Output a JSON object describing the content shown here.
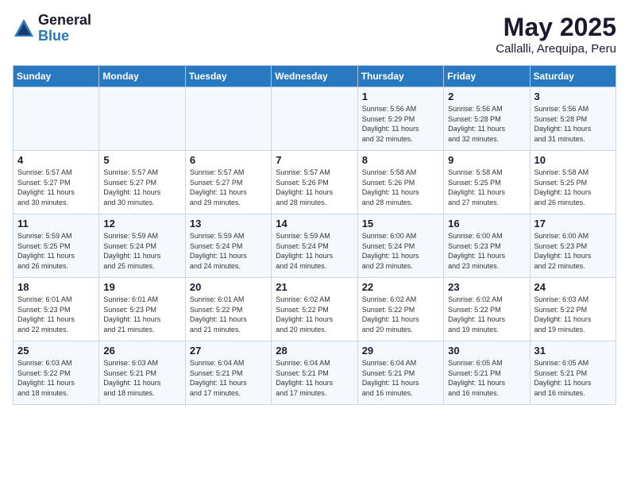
{
  "header": {
    "logo_general": "General",
    "logo_blue": "Blue",
    "month_year": "May 2025",
    "location": "Callalli, Arequipa, Peru"
  },
  "days_of_week": [
    "Sunday",
    "Monday",
    "Tuesday",
    "Wednesday",
    "Thursday",
    "Friday",
    "Saturday"
  ],
  "weeks": [
    [
      {
        "day": "",
        "info": ""
      },
      {
        "day": "",
        "info": ""
      },
      {
        "day": "",
        "info": ""
      },
      {
        "day": "",
        "info": ""
      },
      {
        "day": "1",
        "info": "Sunrise: 5:56 AM\nSunset: 5:29 PM\nDaylight: 11 hours\nand 32 minutes."
      },
      {
        "day": "2",
        "info": "Sunrise: 5:56 AM\nSunset: 5:28 PM\nDaylight: 11 hours\nand 32 minutes."
      },
      {
        "day": "3",
        "info": "Sunrise: 5:56 AM\nSunset: 5:28 PM\nDaylight: 11 hours\nand 31 minutes."
      }
    ],
    [
      {
        "day": "4",
        "info": "Sunrise: 5:57 AM\nSunset: 5:27 PM\nDaylight: 11 hours\nand 30 minutes."
      },
      {
        "day": "5",
        "info": "Sunrise: 5:57 AM\nSunset: 5:27 PM\nDaylight: 11 hours\nand 30 minutes."
      },
      {
        "day": "6",
        "info": "Sunrise: 5:57 AM\nSunset: 5:27 PM\nDaylight: 11 hours\nand 29 minutes."
      },
      {
        "day": "7",
        "info": "Sunrise: 5:57 AM\nSunset: 5:26 PM\nDaylight: 11 hours\nand 28 minutes."
      },
      {
        "day": "8",
        "info": "Sunrise: 5:58 AM\nSunset: 5:26 PM\nDaylight: 11 hours\nand 28 minutes."
      },
      {
        "day": "9",
        "info": "Sunrise: 5:58 AM\nSunset: 5:25 PM\nDaylight: 11 hours\nand 27 minutes."
      },
      {
        "day": "10",
        "info": "Sunrise: 5:58 AM\nSunset: 5:25 PM\nDaylight: 11 hours\nand 26 minutes."
      }
    ],
    [
      {
        "day": "11",
        "info": "Sunrise: 5:59 AM\nSunset: 5:25 PM\nDaylight: 11 hours\nand 26 minutes."
      },
      {
        "day": "12",
        "info": "Sunrise: 5:59 AM\nSunset: 5:24 PM\nDaylight: 11 hours\nand 25 minutes."
      },
      {
        "day": "13",
        "info": "Sunrise: 5:59 AM\nSunset: 5:24 PM\nDaylight: 11 hours\nand 24 minutes."
      },
      {
        "day": "14",
        "info": "Sunrise: 5:59 AM\nSunset: 5:24 PM\nDaylight: 11 hours\nand 24 minutes."
      },
      {
        "day": "15",
        "info": "Sunrise: 6:00 AM\nSunset: 5:24 PM\nDaylight: 11 hours\nand 23 minutes."
      },
      {
        "day": "16",
        "info": "Sunrise: 6:00 AM\nSunset: 5:23 PM\nDaylight: 11 hours\nand 23 minutes."
      },
      {
        "day": "17",
        "info": "Sunrise: 6:00 AM\nSunset: 5:23 PM\nDaylight: 11 hours\nand 22 minutes."
      }
    ],
    [
      {
        "day": "18",
        "info": "Sunrise: 6:01 AM\nSunset: 5:23 PM\nDaylight: 11 hours\nand 22 minutes."
      },
      {
        "day": "19",
        "info": "Sunrise: 6:01 AM\nSunset: 5:23 PM\nDaylight: 11 hours\nand 21 minutes."
      },
      {
        "day": "20",
        "info": "Sunrise: 6:01 AM\nSunset: 5:22 PM\nDaylight: 11 hours\nand 21 minutes."
      },
      {
        "day": "21",
        "info": "Sunrise: 6:02 AM\nSunset: 5:22 PM\nDaylight: 11 hours\nand 20 minutes."
      },
      {
        "day": "22",
        "info": "Sunrise: 6:02 AM\nSunset: 5:22 PM\nDaylight: 11 hours\nand 20 minutes."
      },
      {
        "day": "23",
        "info": "Sunrise: 6:02 AM\nSunset: 5:22 PM\nDaylight: 11 hours\nand 19 minutes."
      },
      {
        "day": "24",
        "info": "Sunrise: 6:03 AM\nSunset: 5:22 PM\nDaylight: 11 hours\nand 19 minutes."
      }
    ],
    [
      {
        "day": "25",
        "info": "Sunrise: 6:03 AM\nSunset: 5:22 PM\nDaylight: 11 hours\nand 18 minutes."
      },
      {
        "day": "26",
        "info": "Sunrise: 6:03 AM\nSunset: 5:21 PM\nDaylight: 11 hours\nand 18 minutes."
      },
      {
        "day": "27",
        "info": "Sunrise: 6:04 AM\nSunset: 5:21 PM\nDaylight: 11 hours\nand 17 minutes."
      },
      {
        "day": "28",
        "info": "Sunrise: 6:04 AM\nSunset: 5:21 PM\nDaylight: 11 hours\nand 17 minutes."
      },
      {
        "day": "29",
        "info": "Sunrise: 6:04 AM\nSunset: 5:21 PM\nDaylight: 11 hours\nand 16 minutes."
      },
      {
        "day": "30",
        "info": "Sunrise: 6:05 AM\nSunset: 5:21 PM\nDaylight: 11 hours\nand 16 minutes."
      },
      {
        "day": "31",
        "info": "Sunrise: 6:05 AM\nSunset: 5:21 PM\nDaylight: 11 hours\nand 16 minutes."
      }
    ]
  ]
}
